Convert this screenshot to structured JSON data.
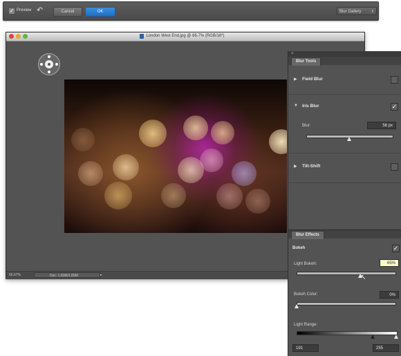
{
  "options_bar": {
    "preview_label": "Preview",
    "cancel_label": "Cancel",
    "ok_label": "OK",
    "mode_dropdown": "Blur Gallery"
  },
  "document": {
    "title": "London West End.jpg @ 66.7% (RGB/16*)",
    "zoom": "66.67%",
    "doc_info": "Doc: 1.83M/1.83M"
  },
  "blur_tools": {
    "tab": "Blur Tools",
    "sections": [
      {
        "name": "Field Blur",
        "enabled": false,
        "expanded": false
      },
      {
        "name": "Iris Blur",
        "enabled": true,
        "expanded": true
      },
      {
        "name": "Tilt-Shift",
        "enabled": false,
        "expanded": false
      }
    ],
    "blur_label": "Blur:",
    "blur_value": "56 px",
    "blur_level": 0.5
  },
  "blur_effects": {
    "tab": "Blur Effects",
    "bokeh_label": "Bokeh",
    "bokeh_enabled": true,
    "light_bokeh_label": "Light Bokeh:",
    "light_bokeh_value": "65%",
    "light_bokeh_level": 0.65,
    "bokeh_color_label": "Bokeh Color:",
    "bokeh_color_value": "0%",
    "bokeh_color_level": 0,
    "light_range_label": "Light Range:",
    "light_range_low": "191",
    "light_range_high": "255"
  }
}
